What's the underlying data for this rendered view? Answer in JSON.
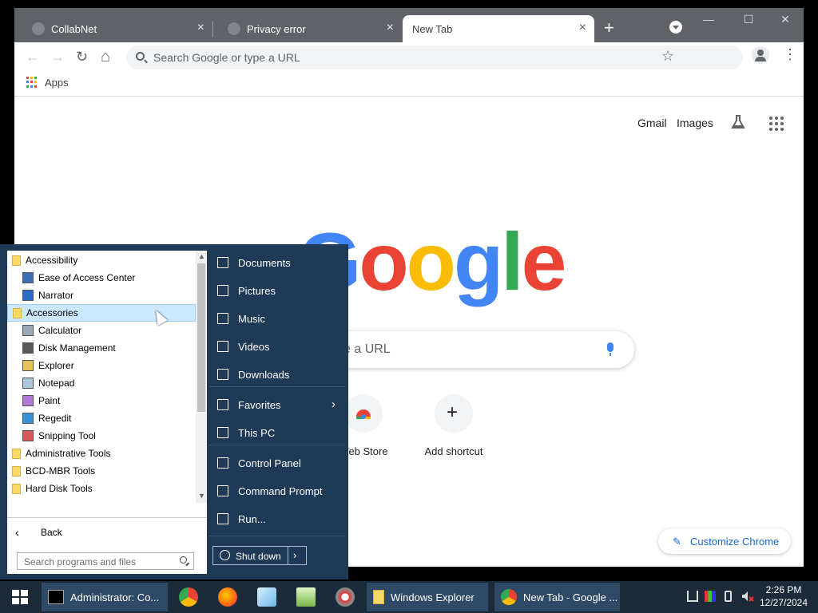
{
  "browser": {
    "tabs": [
      {
        "title": "CollabNet",
        "active": false
      },
      {
        "title": "Privacy error",
        "active": false
      },
      {
        "title": "New Tab",
        "active": true
      }
    ],
    "new_tab_symbol": "+",
    "tab_close_symbol": "×",
    "window_controls": {
      "minimize": "—",
      "maximize": "☐",
      "close": "✕"
    },
    "toolbar": {
      "back_symbol": "←",
      "forward_symbol": "→",
      "reload_symbol": "↻",
      "home_symbol": "⌂",
      "star_symbol": "☆",
      "menu_symbol": "⋮",
      "omnibox_placeholder": "Search Google or type a URL"
    },
    "bookmarks_bar": {
      "apps_label": "Apps"
    },
    "colors": {
      "apps_dots": [
        "#ea4335",
        "#fbbc05",
        "#34a853",
        "#4285f4",
        "#ea4335",
        "#fbbc05",
        "#34a853",
        "#4285f4",
        "#ea4335"
      ]
    }
  },
  "ntp": {
    "links": [
      "Gmail",
      "Images"
    ],
    "logo": {
      "letters": [
        "G",
        "o",
        "o",
        "g",
        "l",
        "e"
      ],
      "colors": [
        "#4285f4",
        "#ea4335",
        "#fbbc05",
        "#4285f4",
        "#34a853",
        "#ea4335"
      ]
    },
    "search_visible_text": "e a URL",
    "shortcuts": [
      {
        "label": "Web Store",
        "icon": "chrome-web-store-icon"
      },
      {
        "label": "Add shortcut",
        "icon": "plus-icon",
        "symbol": "+"
      }
    ],
    "customize_label": "Customize Chrome",
    "customize_icon": "✎"
  },
  "start_menu": {
    "programs": [
      {
        "label": "Accessibility",
        "type": "folder"
      },
      {
        "label": "Ease of Access Center",
        "type": "app"
      },
      {
        "label": "Narrator",
        "type": "app"
      },
      {
        "label": "Accessories",
        "type": "folder",
        "selected": true
      },
      {
        "label": "Calculator",
        "type": "app"
      },
      {
        "label": "Disk Management",
        "type": "app"
      },
      {
        "label": "Explorer",
        "type": "app"
      },
      {
        "label": "Notepad",
        "type": "app"
      },
      {
        "label": "Paint",
        "type": "app"
      },
      {
        "label": "Regedit",
        "type": "app"
      },
      {
        "label": "Snipping Tool",
        "type": "app"
      },
      {
        "label": "Administrative Tools",
        "type": "folder"
      },
      {
        "label": "BCD-MBR Tools",
        "type": "folder"
      },
      {
        "label": "Hard Disk Tools",
        "type": "folder"
      }
    ],
    "back_label": "Back",
    "back_symbol": "‹",
    "search_placeholder": "Search programs and files",
    "right_items": [
      {
        "label": "Documents",
        "icon": "document-icon"
      },
      {
        "label": "Pictures",
        "icon": "picture-icon"
      },
      {
        "label": "Music",
        "icon": "music-icon"
      },
      {
        "label": "Videos",
        "icon": "video-icon"
      },
      {
        "label": "Downloads",
        "icon": "download-icon"
      },
      {
        "label": "Favorites",
        "icon": "star-icon",
        "submenu": true
      },
      {
        "label": "This PC",
        "icon": "computer-icon"
      },
      {
        "label": "Control Panel",
        "icon": "control-panel-icon"
      },
      {
        "label": "Command Prompt",
        "icon": "terminal-icon"
      },
      {
        "label": "Run...",
        "icon": "run-icon"
      }
    ],
    "submenu_symbol": "›",
    "shutdown_label": "Shut down",
    "shutdown_arrow": "›"
  },
  "taskbar": {
    "windows": [
      {
        "label": "Administrator: Co...",
        "icon": "cmd-icon"
      },
      {
        "label": "Windows Explorer",
        "icon": "folder-icon"
      },
      {
        "label": "New Tab - Google ...",
        "icon": "chrome-icon"
      }
    ],
    "pinned": [
      {
        "name": "chrome-icon"
      },
      {
        "name": "firefox-icon"
      },
      {
        "name": "crystal-icon"
      },
      {
        "name": "chart-app-icon"
      },
      {
        "name": "disk-app-icon"
      }
    ],
    "clock": {
      "time": "2:26 PM",
      "date": "12/27/2024"
    },
    "colors": {
      "taskbar_bg": "#1c2b3a",
      "start_menu_bg": "#1f3a56"
    }
  }
}
